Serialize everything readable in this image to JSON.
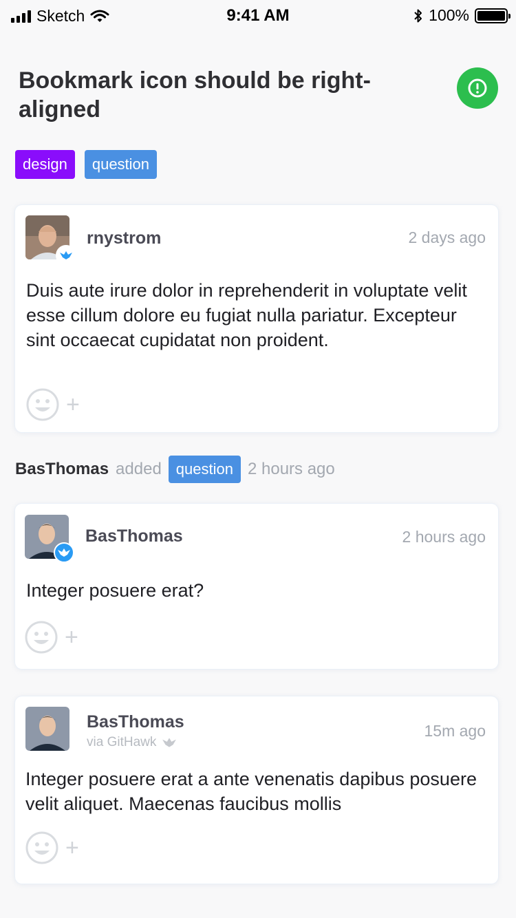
{
  "status_bar": {
    "carrier": "Sketch",
    "time": "9:41 AM",
    "battery": "100%"
  },
  "issue": {
    "title": "Bookmark icon should be right-aligned",
    "status_color": "#2cbe4e",
    "labels": [
      {
        "name": "design",
        "color": "#8a0dfb"
      },
      {
        "name": "question",
        "color": "#4a90e2"
      }
    ]
  },
  "comments": [
    {
      "author": "rnystrom",
      "time": "2 days ago",
      "body": "Duis aute irure dolor in reprehenderit in voluptate velit esse cillum dolore eu fugiat nulla pariatur. Excepteur sint occaecat cupidatat non proident.",
      "badge": "githawk-icon"
    },
    {
      "author": "BasThomas",
      "time": "2 hours ago",
      "body": "Integer posuere erat?",
      "badge": "githawk-icon"
    },
    {
      "author": "BasThomas",
      "time": "15m ago",
      "via": "via GitHawk",
      "body": "Integer posuere erat a ante venenatis dapibus posuere velit aliquet. Maecenas faucibus mollis"
    }
  ],
  "event": {
    "actor": "BasThomas",
    "action": "added",
    "label": "question",
    "time": "2 hours ago"
  }
}
